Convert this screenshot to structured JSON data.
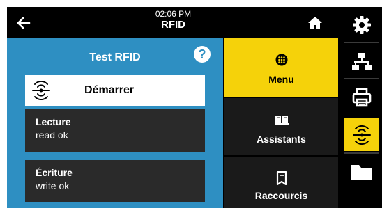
{
  "header": {
    "time": "02:06 PM",
    "title": "RFID",
    "back_icon": "arrow-left-icon",
    "home_icon": "home-icon"
  },
  "test_panel": {
    "title": "Test RFID",
    "help_icon": "help-icon",
    "help_glyph": "?",
    "start_button": {
      "label": "Démarrer",
      "icon": "rfid-icon"
    },
    "results": [
      {
        "label": "Lecture",
        "value": "read ok"
      },
      {
        "label": "Écriture",
        "value": "write ok"
      }
    ]
  },
  "menu_tiles": [
    {
      "label": "Menu",
      "icon": "menu-dots-icon",
      "active": true
    },
    {
      "label": "Assistants",
      "icon": "book-icon",
      "active": false
    },
    {
      "label": "Raccourcis",
      "icon": "bookmark-icon",
      "active": false
    }
  ],
  "toolbar": [
    {
      "name": "settings",
      "icon": "gear-icon",
      "active": false
    },
    {
      "name": "network",
      "icon": "network-icon",
      "active": false
    },
    {
      "name": "printer",
      "icon": "printer-icon",
      "active": false
    },
    {
      "name": "rfid",
      "icon": "rfid-icon",
      "active": true
    },
    {
      "name": "storage",
      "icon": "folder-icon",
      "active": false
    }
  ],
  "colors": {
    "accent": "#f5d20a",
    "panel_blue": "#2e8fc2",
    "background": "#000000"
  }
}
